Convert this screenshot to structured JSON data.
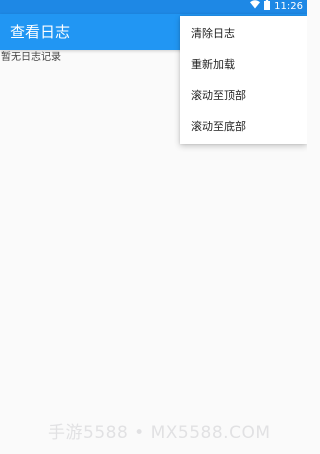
{
  "status_bar": {
    "time": "11:26",
    "wifi_icon": "wifi-icon",
    "battery_icon": "battery-icon"
  },
  "app_bar": {
    "title": "查看日志"
  },
  "content": {
    "empty_message": "暂无日志记录"
  },
  "menu": {
    "items": [
      {
        "label": "清除日志"
      },
      {
        "label": "重新加载"
      },
      {
        "label": "滚动至顶部"
      },
      {
        "label": "滚动至底部"
      }
    ]
  },
  "watermark": {
    "text": "手游5588 • MX5588.COM"
  },
  "colors": {
    "primary": "#2196f3",
    "status_bar": "#1e88e5",
    "background": "#fafafa"
  }
}
